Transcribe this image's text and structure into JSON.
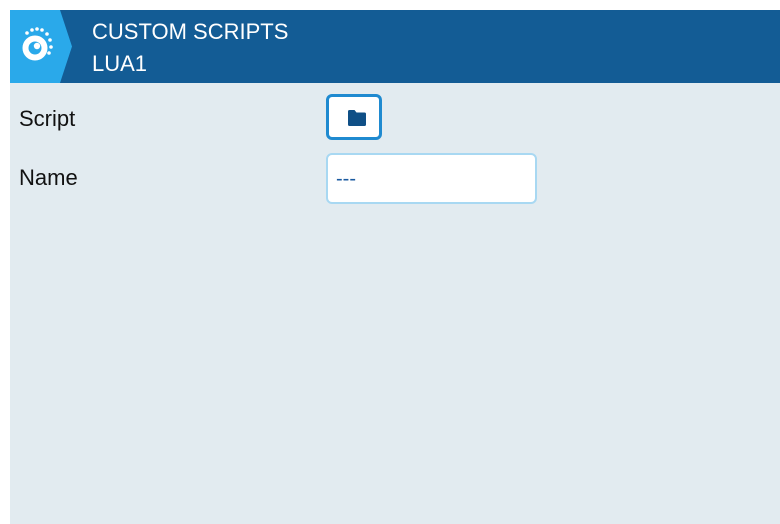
{
  "header": {
    "logo_icon": "ethos-logo-icon",
    "title": "CUSTOM SCRIPTS",
    "subtitle": "LUA1"
  },
  "form": {
    "script": {
      "label": "Script",
      "button_icon": "folder-icon"
    },
    "name": {
      "label": "Name",
      "value": "---"
    }
  },
  "colors": {
    "header_bg": "#135c95",
    "accent_light": "#2aa9ea",
    "panel_bg": "#e2ebf0",
    "button_border": "#1f8ad0",
    "field_border": "#a8d8f2",
    "folder_icon": "#0f4f86"
  }
}
